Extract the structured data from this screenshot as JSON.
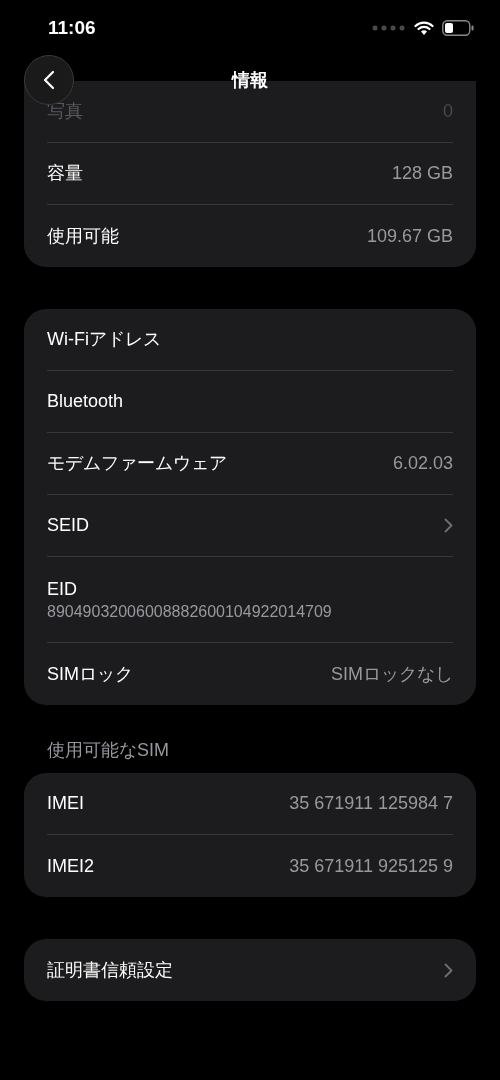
{
  "status_bar": {
    "time": "11:06"
  },
  "nav": {
    "title": "情報"
  },
  "groups": [
    {
      "rows": [
        {
          "kind": "value",
          "label": "写真",
          "value": "0",
          "faded": true
        },
        {
          "kind": "value",
          "label": "容量",
          "value": "128 GB",
          "faded": false
        },
        {
          "kind": "value",
          "label": "使用可能",
          "value": "109.67 GB",
          "faded": false
        }
      ],
      "open_top": true
    },
    {
      "rows": [
        {
          "kind": "value",
          "label": "Wi-Fiアドレス",
          "faded": false
        },
        {
          "kind": "value",
          "label": "Bluetooth",
          "faded": false
        },
        {
          "kind": "value",
          "label": "モデムファームウェア",
          "value": "6.02.03",
          "faded": false
        },
        {
          "kind": "link",
          "label": "SEID",
          "faded": false
        },
        {
          "kind": "stacked",
          "label": "EID",
          "value": "89049032006008882600104922014709",
          "faded": false
        },
        {
          "kind": "value",
          "label": "SIMロック",
          "value": "SIMロックなし",
          "faded": false
        }
      ],
      "open_top": false
    },
    {
      "header": "使用可能なSIM",
      "rows": [
        {
          "kind": "value",
          "label": "IMEI",
          "value": "35 671911 125984 7",
          "faded": false
        },
        {
          "kind": "value",
          "label": "IMEI2",
          "value": "35 671911 925125 9",
          "faded": false
        }
      ],
      "open_top": false
    },
    {
      "rows": [
        {
          "kind": "link",
          "label": "証明書信頼設定",
          "faded": false
        }
      ],
      "open_top": false
    }
  ]
}
